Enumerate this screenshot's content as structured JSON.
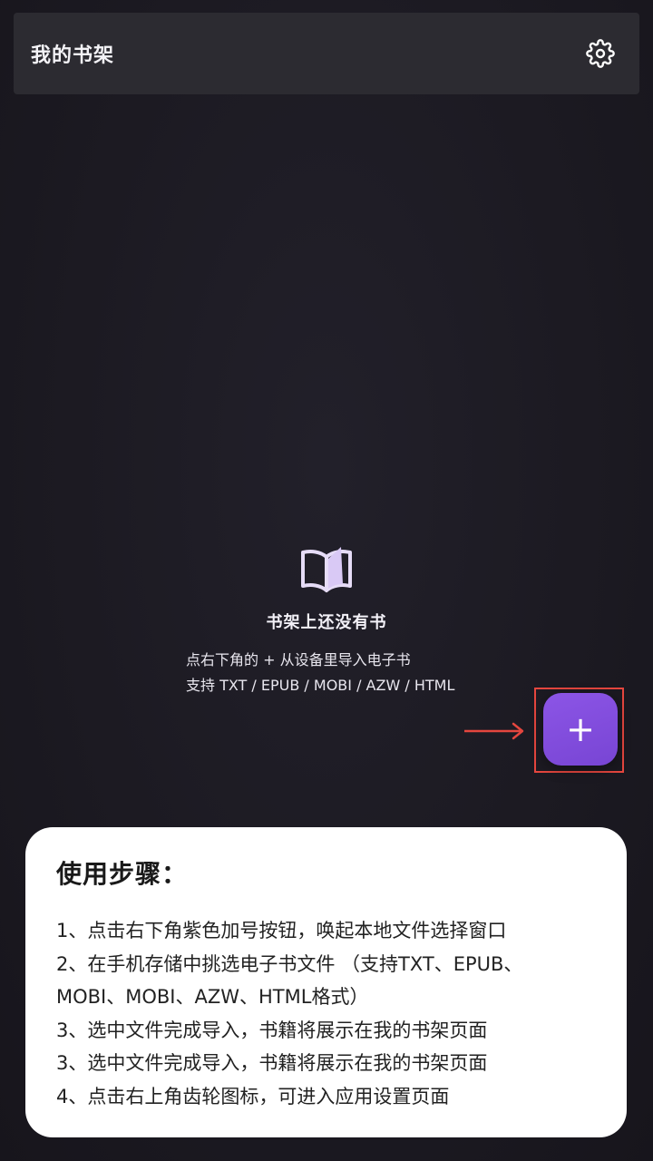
{
  "header": {
    "title": "我的书架",
    "settings_icon": "gear-icon"
  },
  "empty_state": {
    "icon": "open-book-icon",
    "title": "书架上还没有书",
    "line1": "点右下角的 + 从设备里导入电子书",
    "line2": "支持 TXT / EPUB / MOBI / AZW / HTML"
  },
  "fab": {
    "label": "+",
    "color": "#7f4bdc"
  },
  "annotation": {
    "arrow_color": "#e5463e",
    "highlight_color": "#e5463e"
  },
  "steps": {
    "title": "使用步骤：",
    "lines": [
      "1、点击右下角紫色加号按钮，唤起本地文件选择窗口",
      "2、在手机存储中挑选电子书文件 （支持TXT、EPUB、",
      "MOBI、MOBI、AZW、HTML格式）",
      "3、选中文件完成导入，书籍将展示在我的书架页面",
      "3、选中文件完成导入，书籍将展示在我的书架页面",
      "4、点击右上角齿轮图标，可进入应用设置页面"
    ]
  }
}
